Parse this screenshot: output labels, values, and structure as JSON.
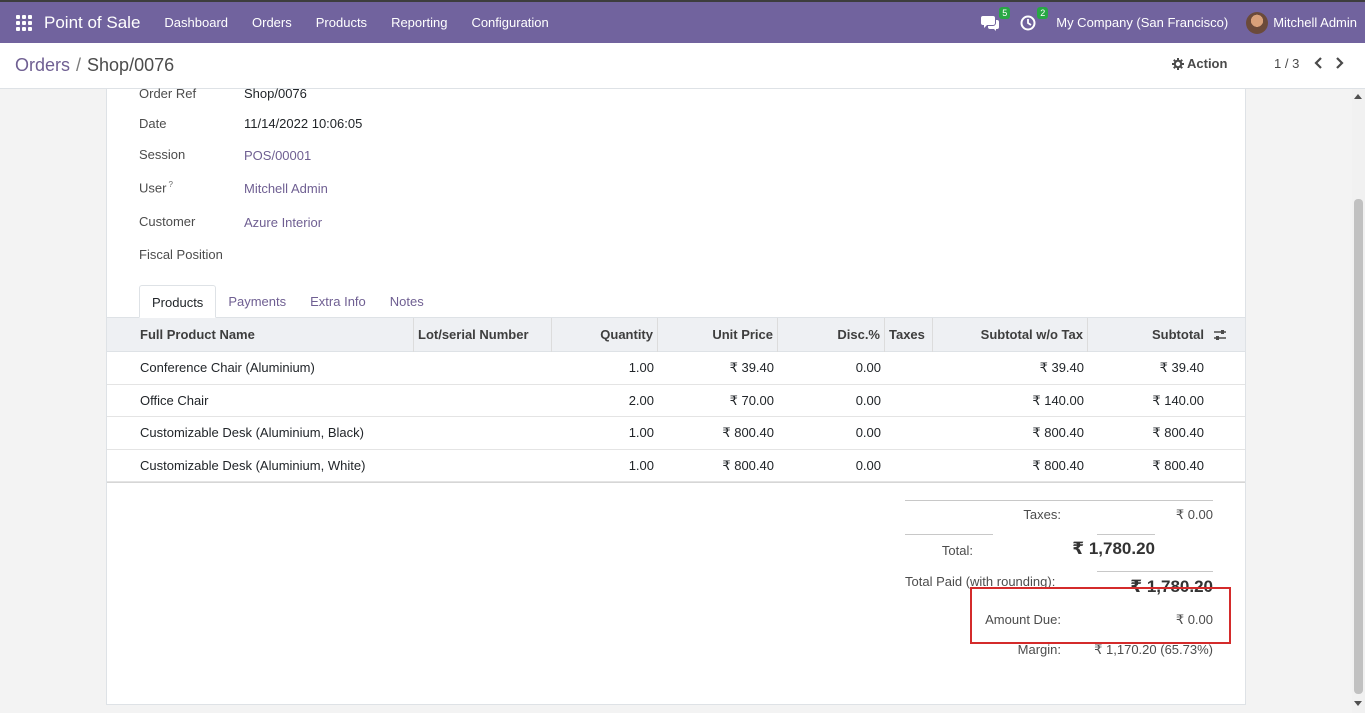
{
  "navbar": {
    "brand": "Point of Sale",
    "menu": [
      "Dashboard",
      "Orders",
      "Products",
      "Reporting",
      "Configuration"
    ],
    "messages_count": "5",
    "activities_count": "2",
    "company": "My Company (San Francisco)",
    "user": "Mitchell Admin"
  },
  "breadcrumb": {
    "parent": "Orders",
    "separator": "/",
    "current": "Shop/0076"
  },
  "control": {
    "action_label": "Action",
    "pager": "1 / 3"
  },
  "form": {
    "order_ref_label": "Order Ref",
    "order_ref": "Shop/0076",
    "date_label": "Date",
    "date": "11/14/2022 10:06:05",
    "session_label": "Session",
    "session": "POS/00001",
    "user_label": "User",
    "user_help": "?",
    "user": "Mitchell Admin",
    "customer_label": "Customer",
    "customer": "Azure Interior",
    "fiscal_position_label": "Fiscal Position"
  },
  "tabs": [
    "Products",
    "Payments",
    "Extra Info",
    "Notes"
  ],
  "table": {
    "headers": [
      "Full Product Name",
      "Lot/serial Number",
      "Quantity",
      "Unit Price",
      "Disc.%",
      "Taxes",
      "Subtotal w/o Tax",
      "Subtotal"
    ],
    "rows": [
      {
        "name": "Conference Chair (Aluminium)",
        "lot": "",
        "qty": "1.00",
        "price": "₹ 39.40",
        "disc": "0.00",
        "taxes": "",
        "subtotal_wo": "₹ 39.40",
        "subtotal": "₹ 39.40"
      },
      {
        "name": "Office Chair",
        "lot": "",
        "qty": "2.00",
        "price": "₹ 70.00",
        "disc": "0.00",
        "taxes": "",
        "subtotal_wo": "₹ 140.00",
        "subtotal": "₹ 140.00"
      },
      {
        "name": "Customizable Desk (Aluminium, Black)",
        "lot": "",
        "qty": "1.00",
        "price": "₹ 800.40",
        "disc": "0.00",
        "taxes": "",
        "subtotal_wo": "₹ 800.40",
        "subtotal": "₹ 800.40"
      },
      {
        "name": "Customizable Desk (Aluminium, White)",
        "lot": "",
        "qty": "1.00",
        "price": "₹ 800.40",
        "disc": "0.00",
        "taxes": "",
        "subtotal_wo": "₹ 800.40",
        "subtotal": "₹ 800.40"
      }
    ]
  },
  "totals": {
    "taxes_label": "Taxes:",
    "taxes": "₹ 0.00",
    "total_label": "Total:",
    "total": "₹ 1,780.20",
    "total_paid_label": "Total Paid (with rounding):",
    "total_paid": "₹ 1,780.20",
    "amount_due_label": "Amount Due:",
    "amount_due": "₹ 0.00",
    "margin_label": "Margin:",
    "margin": "₹ 1,170.20 (65.73%)"
  },
  "colors": {
    "navbar": "#71639e",
    "link": "#6f5f92",
    "highlight": "#d42b2b"
  }
}
